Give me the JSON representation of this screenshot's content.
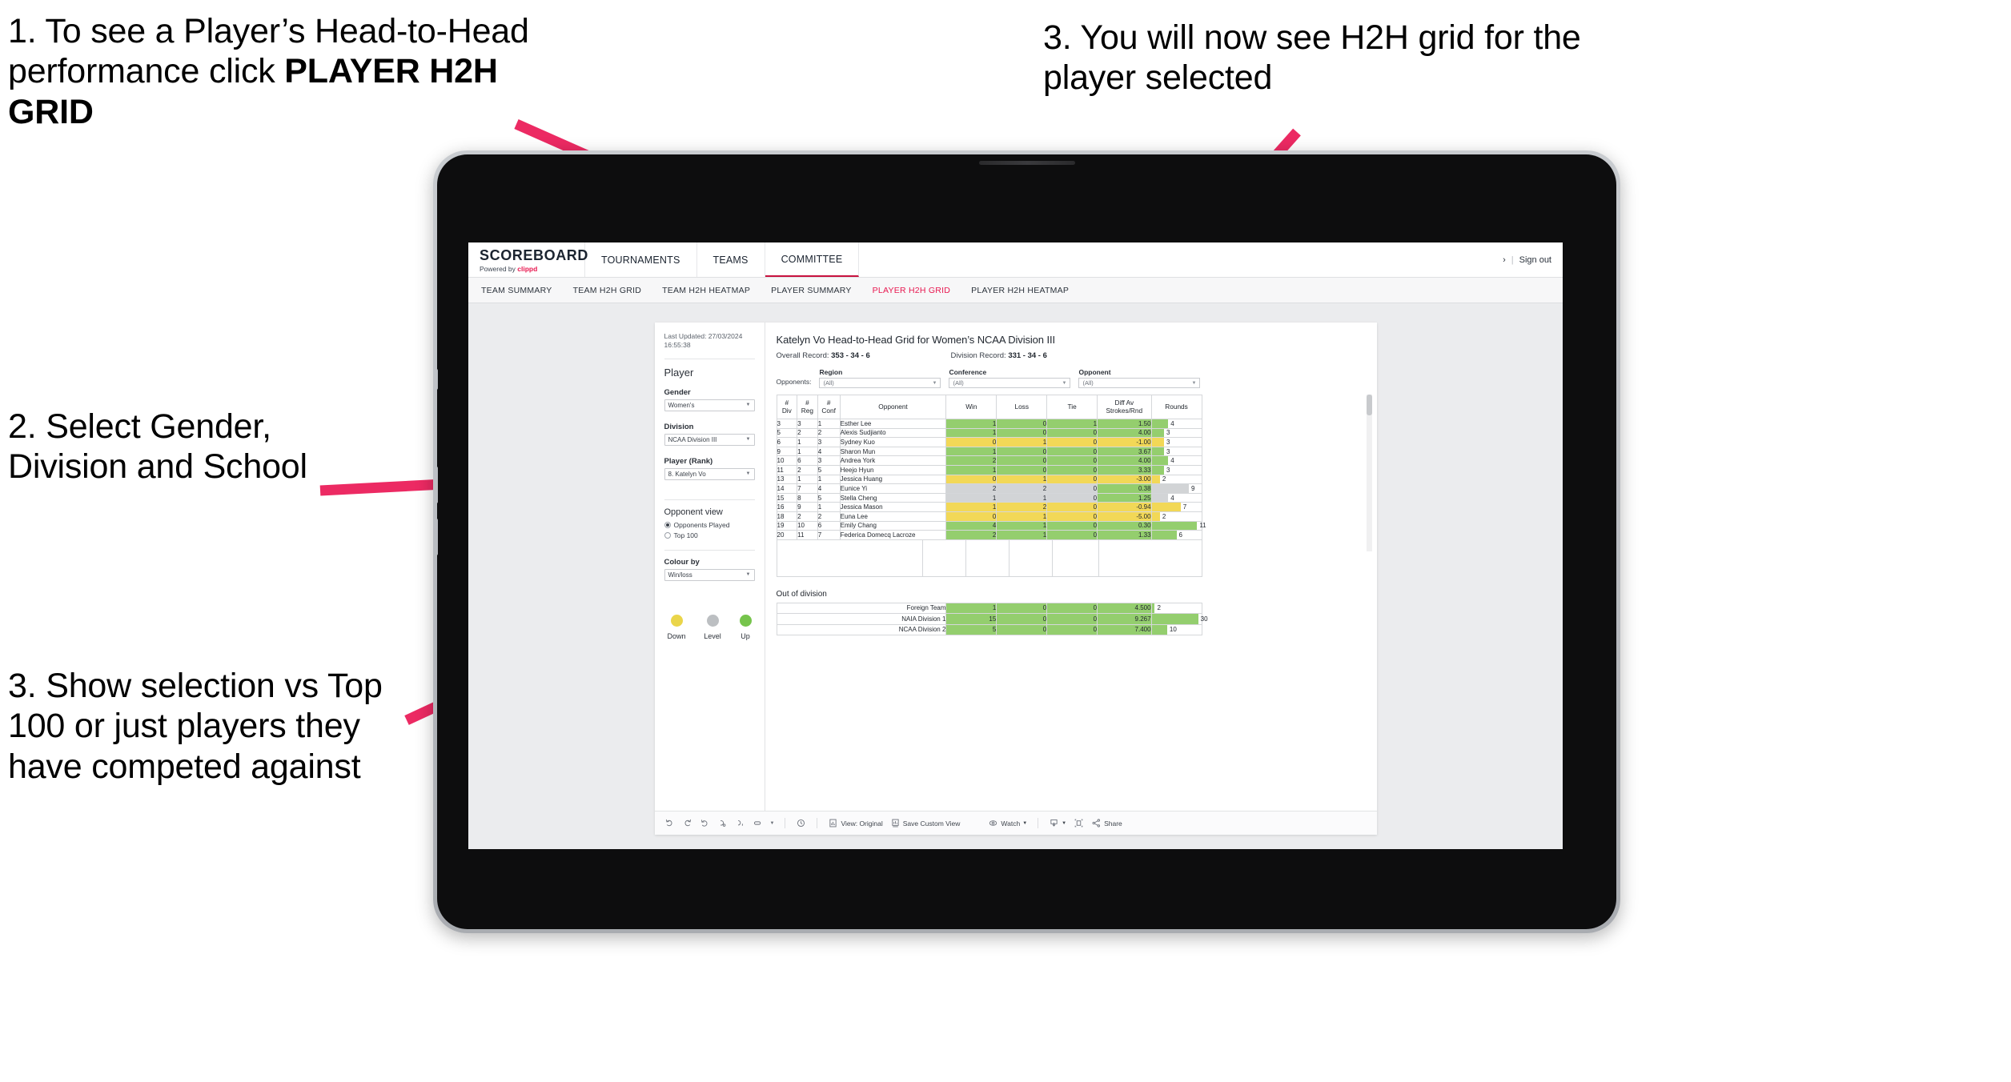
{
  "annotations": {
    "step1_a": "1. To see a Player’s Head-to-Head performance click ",
    "step1_b": "PLAYER H2H GRID",
    "step2": "2. Select Gender, Division and School",
    "step3": "3. Show selection vs Top 100 or just players they have competed against",
    "step4": "3. You will now see H2H grid for the player selected"
  },
  "brand": {
    "title": "SCOREBOARD",
    "powered_prefix": "Powered by ",
    "powered_name": "clippd"
  },
  "topnav": {
    "items": [
      "TOURNAMENTS",
      "TEAMS",
      "COMMITTEE"
    ],
    "active": "COMMITTEE"
  },
  "account": {
    "caret": "›",
    "separator": "|",
    "sign_out": "Sign out"
  },
  "subnav": {
    "items": [
      "TEAM SUMMARY",
      "TEAM H2H GRID",
      "TEAM H2H HEATMAP",
      "PLAYER SUMMARY",
      "PLAYER H2H GRID",
      "PLAYER H2H HEATMAP"
    ],
    "active": "PLAYER H2H GRID"
  },
  "sidebar": {
    "last_updated": "Last Updated: 27/03/2024 16:55:38",
    "section_player": "Player",
    "gender": {
      "label": "Gender",
      "value": "Women's"
    },
    "division": {
      "label": "Division",
      "value": "NCAA Division III"
    },
    "player_rank": {
      "label": "Player (Rank)",
      "value": "8. Katelyn Vo"
    },
    "opponent_view": {
      "label": "Opponent view",
      "options": [
        "Opponents Played",
        "Top 100"
      ],
      "selected": "Opponents Played"
    },
    "colour_by": {
      "label": "Colour by",
      "value": "Win/loss"
    },
    "legend": [
      {
        "label": "Down",
        "color": "#ead54a"
      },
      {
        "label": "Level",
        "color": "#bcbfc2"
      },
      {
        "label": "Up",
        "color": "#76c44c"
      }
    ]
  },
  "main": {
    "title": "Katelyn Vo Head-to-Head Grid for Women’s NCAA Division III",
    "overall_record_label": "Overall Record:",
    "overall_record_value": "353 -  34 - 6",
    "division_record_label": "Division Record:",
    "division_record_value": "331 -  34 - 6",
    "opponents_label": "Opponents:",
    "filters": [
      {
        "label": "Region",
        "value": "(All)"
      },
      {
        "label": "Conference",
        "value": "(All)"
      },
      {
        "label": "Opponent",
        "value": "(All)"
      }
    ],
    "out_of_division_title": "Out of division"
  },
  "chart_data": {
    "type": "table",
    "title": "Katelyn Vo Head-to-Head Grid for Women’s NCAA Division III",
    "columns": [
      "# Div",
      "# Reg",
      "# Conf",
      "Opponent",
      "Win",
      "Loss",
      "Tie",
      "Diff Av Strokes/Rnd",
      "Rounds"
    ],
    "column_lines": [
      [
        "#",
        "Div"
      ],
      [
        "#",
        "Reg"
      ],
      [
        "#",
        "Conf"
      ],
      [
        "Opponent"
      ],
      [
        "Win"
      ],
      [
        "Loss"
      ],
      [
        "Tie"
      ],
      [
        "Diff Av",
        "Strokes/Rnd"
      ],
      [
        "Rounds"
      ]
    ],
    "rounds_max": 12,
    "rows": [
      {
        "div": "3",
        "reg": "3",
        "conf": "1",
        "opponent": "Esther Lee",
        "win": "1",
        "loss": "0",
        "tie": "1",
        "diff": "1.50",
        "rounds": "4",
        "rounds_val": 4,
        "state": "up"
      },
      {
        "div": "5",
        "reg": "2",
        "conf": "2",
        "opponent": "Alexis Sudjianto",
        "win": "1",
        "loss": "0",
        "tie": "0",
        "diff": "4.00",
        "rounds": "3",
        "rounds_val": 3,
        "state": "up"
      },
      {
        "div": "6",
        "reg": "1",
        "conf": "3",
        "opponent": "Sydney Kuo",
        "win": "0",
        "loss": "1",
        "tie": "0",
        "diff": "-1.00",
        "rounds": "3",
        "rounds_val": 3,
        "state": "down"
      },
      {
        "div": "9",
        "reg": "1",
        "conf": "4",
        "opponent": "Sharon Mun",
        "win": "1",
        "loss": "0",
        "tie": "0",
        "diff": "3.67",
        "rounds": "3",
        "rounds_val": 3,
        "state": "up"
      },
      {
        "div": "10",
        "reg": "6",
        "conf": "3",
        "opponent": "Andrea York",
        "win": "2",
        "loss": "0",
        "tie": "0",
        "diff": "4.00",
        "rounds": "4",
        "rounds_val": 4,
        "state": "up"
      },
      {
        "div": "11",
        "reg": "2",
        "conf": "5",
        "opponent": "Heejo Hyun",
        "win": "1",
        "loss": "0",
        "tie": "0",
        "diff": "3.33",
        "rounds": "3",
        "rounds_val": 3,
        "state": "up"
      },
      {
        "div": "13",
        "reg": "1",
        "conf": "1",
        "opponent": "Jessica Huang",
        "win": "0",
        "loss": "1",
        "tie": "0",
        "diff": "-3.00",
        "rounds": "2",
        "rounds_val": 2,
        "state": "down"
      },
      {
        "div": "14",
        "reg": "7",
        "conf": "4",
        "opponent": "Eunice Yi",
        "win": "2",
        "loss": "2",
        "tie": "0",
        "diff": "0.38",
        "rounds": "9",
        "rounds_val": 9,
        "state": "level",
        "diff_state": "up"
      },
      {
        "div": "15",
        "reg": "8",
        "conf": "5",
        "opponent": "Stella Cheng",
        "win": "1",
        "loss": "1",
        "tie": "0",
        "diff": "1.25",
        "rounds": "4",
        "rounds_val": 4,
        "state": "level",
        "diff_state": "up"
      },
      {
        "div": "16",
        "reg": "9",
        "conf": "1",
        "opponent": "Jessica Mason",
        "win": "1",
        "loss": "2",
        "tie": "0",
        "diff": "-0.94",
        "rounds": "7",
        "rounds_val": 7,
        "state": "down"
      },
      {
        "div": "18",
        "reg": "2",
        "conf": "2",
        "opponent": "Euna Lee",
        "win": "0",
        "loss": "1",
        "tie": "0",
        "diff": "-5.00",
        "rounds": "2",
        "rounds_val": 2,
        "state": "down"
      },
      {
        "div": "19",
        "reg": "10",
        "conf": "6",
        "opponent": "Emily Chang",
        "win": "4",
        "loss": "1",
        "tie": "0",
        "diff": "0.30",
        "rounds": "11",
        "rounds_val": 11,
        "state": "up"
      },
      {
        "div": "20",
        "reg": "11",
        "conf": "7",
        "opponent": "Federica Domecq Lacroze",
        "win": "2",
        "loss": "1",
        "tie": "0",
        "diff": "1.33",
        "rounds": "6",
        "rounds_val": 6,
        "state": "up"
      }
    ],
    "out_of_division": {
      "rounds_max": 32,
      "rows": [
        {
          "name": "Foreign Team",
          "win": "1",
          "loss": "0",
          "tie": "0",
          "diff": "4.500",
          "rounds": "2",
          "rounds_val": 2,
          "state": "up"
        },
        {
          "name": "NAIA Division 1",
          "win": "15",
          "loss": "0",
          "tie": "0",
          "diff": "9.267",
          "rounds": "30",
          "rounds_val": 30,
          "state": "up"
        },
        {
          "name": "NCAA Division 2",
          "win": "5",
          "loss": "0",
          "tie": "0",
          "diff": "7.400",
          "rounds": "10",
          "rounds_val": 10,
          "state": "up"
        }
      ]
    },
    "colors": {
      "up": "#94ce6e",
      "down": "#f2d857",
      "level": "#d2d4d6",
      "accent": "#e8174f"
    }
  },
  "toolbar": {
    "view_label": "View: Original",
    "save_label": "Save Custom View",
    "watch_label": "Watch",
    "share_label": "Share",
    "caret": "▾"
  }
}
